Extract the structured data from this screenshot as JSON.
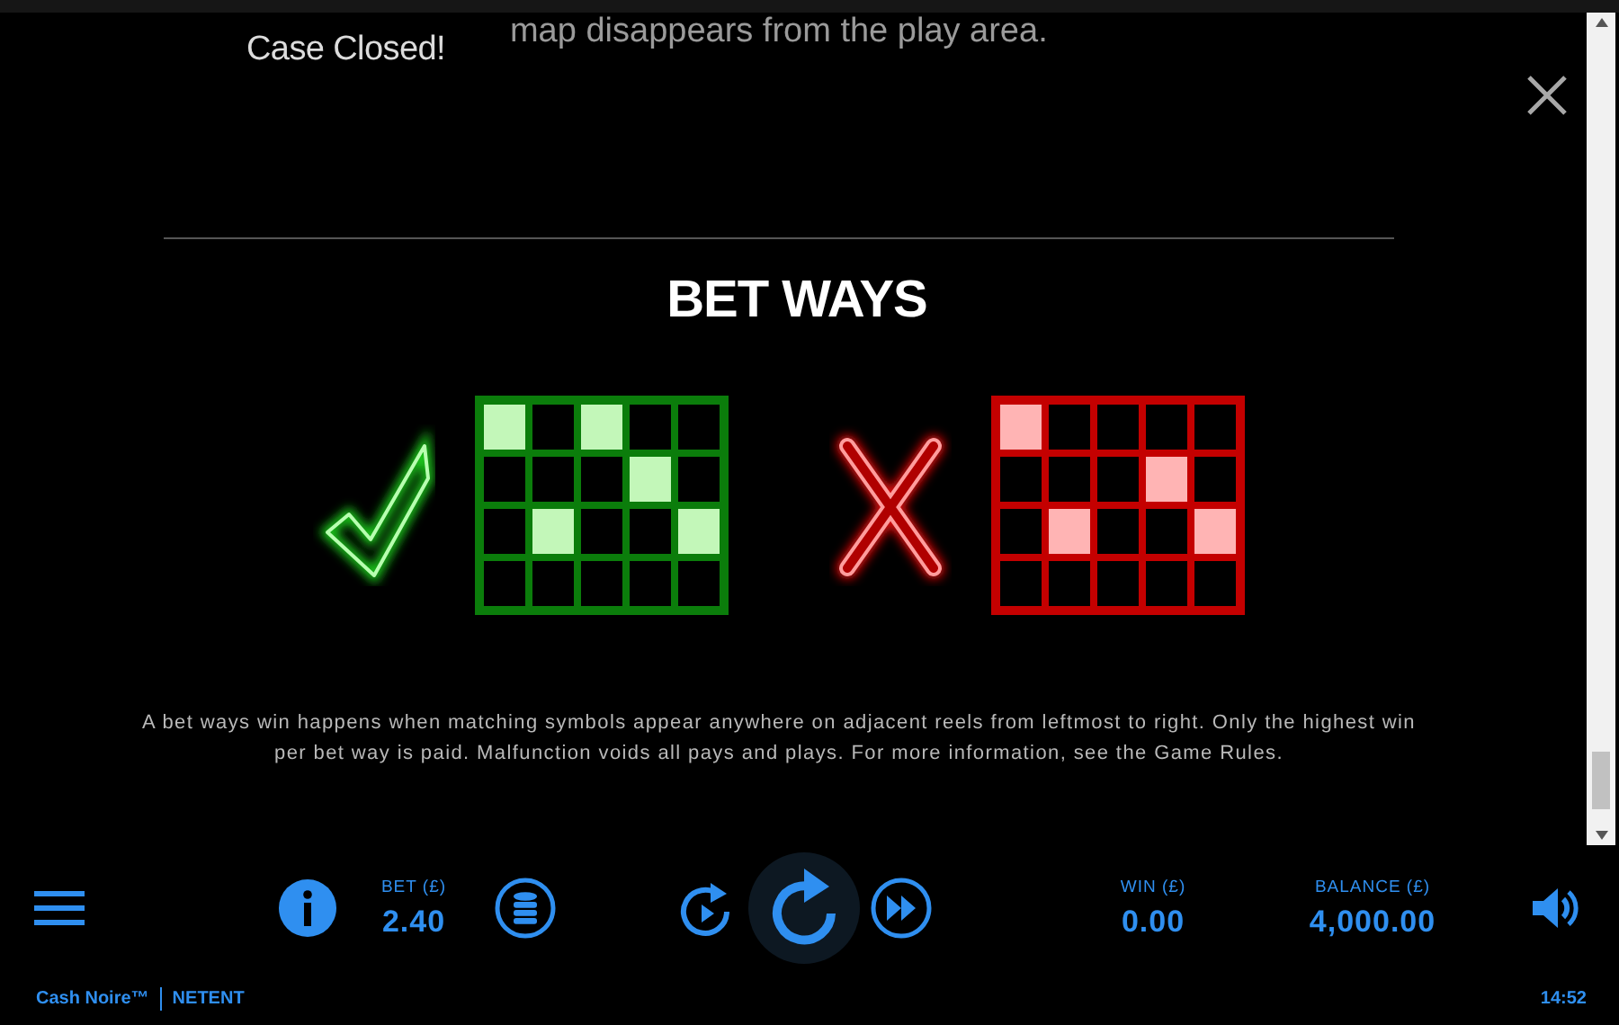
{
  "intro": {
    "title": "Case Closed!",
    "text": "map disappears from the play area."
  },
  "section": {
    "title": "BET WAYS",
    "examples": [
      {
        "kind": "valid",
        "rows": [
          [
            true,
            false,
            true,
            false,
            false
          ],
          [
            false,
            false,
            false,
            true,
            false
          ],
          [
            false,
            true,
            false,
            false,
            true
          ],
          [
            false,
            false,
            false,
            false,
            false
          ]
        ]
      },
      {
        "kind": "invalid",
        "rows": [
          [
            true,
            false,
            false,
            false,
            false
          ],
          [
            false,
            false,
            false,
            true,
            false
          ],
          [
            false,
            true,
            false,
            false,
            true
          ],
          [
            false,
            false,
            false,
            false,
            false
          ]
        ]
      }
    ],
    "description": "A bet ways win happens when matching symbols appear anywhere on adjacent reels from leftmost to right. Only the highest win per bet way is paid. Malfunction voids all pays and plays. For more information, see the Game Rules."
  },
  "controls": {
    "bet": {
      "label": "BET (£)",
      "value": "2.40"
    },
    "win": {
      "label": "WIN (£)",
      "value": "0.00"
    },
    "balance": {
      "label": "BALANCE (£)",
      "value": "4,000.00"
    }
  },
  "footer": {
    "game": "Cash Noire™",
    "provider": "NETENT",
    "time": "14:52"
  }
}
